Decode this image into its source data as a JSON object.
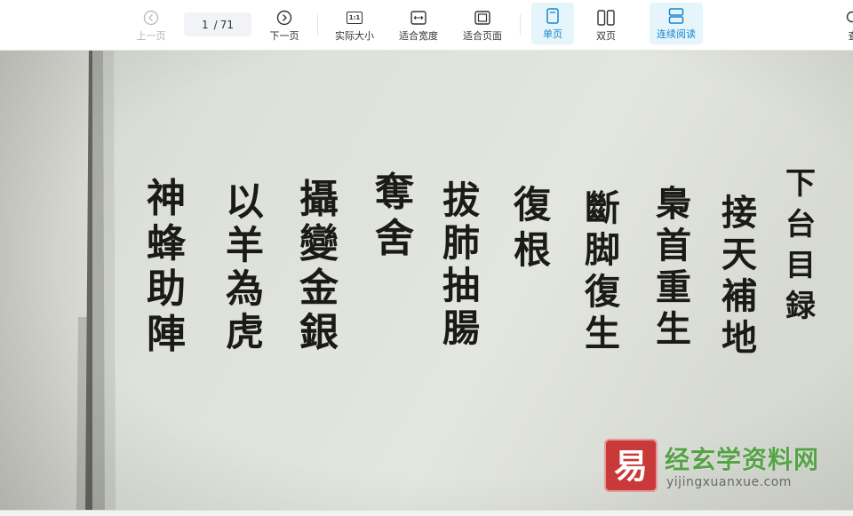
{
  "toolbar": {
    "prev_label": "上一页",
    "next_label": "下一页",
    "page_current": "1",
    "page_total": "71",
    "actual_size_label": "实际大小",
    "actual_size_glyph": "1:1",
    "fit_width_label": "适合宽度",
    "fit_page_label": "适合页面",
    "single_page_label": "单页",
    "double_page_label": "双页",
    "continuous_label": "连续阅读",
    "search_label_partial": "查",
    "active_color": "#1687c9",
    "disabled_color": "#b4b4b4"
  },
  "document": {
    "columns": [
      {
        "text": [
          "下",
          "台",
          "目",
          "録"
        ]
      },
      {
        "text": [
          "接",
          "天",
          "補",
          "地"
        ]
      },
      {
        "text": [
          "梟",
          "首",
          "重",
          "生"
        ]
      },
      {
        "text": [
          "斷",
          "脚",
          "復",
          "生"
        ]
      },
      {
        "text": [
          "復",
          "根"
        ]
      },
      {
        "text": [
          "拔",
          "肺",
          "抽",
          "腸"
        ]
      },
      {
        "text": [
          "奪",
          "舍"
        ]
      },
      {
        "text": [
          "攝",
          "變",
          "金",
          "銀"
        ]
      },
      {
        "text": [
          "以",
          "羊",
          "為",
          "虎"
        ]
      },
      {
        "text": [
          "神",
          "蜂",
          "助",
          "陣"
        ]
      }
    ]
  },
  "watermark": {
    "logo_glyph": "易",
    "site_name": "经玄学资料网",
    "url": "yijingxuanxue.com",
    "brand_red": "#c9393a",
    "brand_green": "#56a346"
  }
}
